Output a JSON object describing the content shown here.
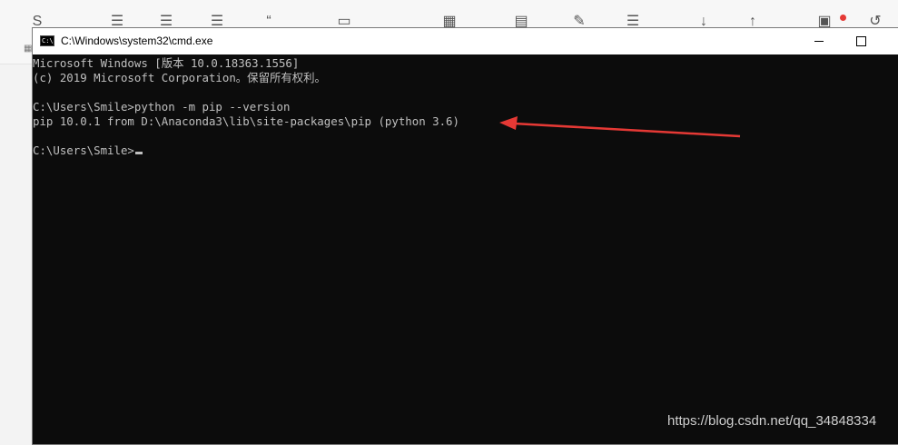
{
  "window": {
    "title": "C:\\Windows\\system32\\cmd.exe",
    "icon": "cmd-icon",
    "controls": [
      "minimize-icon",
      "maximize-icon",
      "close-icon"
    ]
  },
  "console": {
    "lines": [
      "Microsoft Windows [版本 10.0.18363.1556]",
      "(c) 2019 Microsoft Corporation。保留所有权利。",
      "",
      "C:\\Users\\Smile>python -m pip --version",
      "pip 10.0.1 from D:\\Anaconda3\\lib\\site-packages\\pip (python 3.6)",
      "",
      "C:\\Users\\Smile>"
    ]
  },
  "annotation": {
    "color": "#e53935"
  },
  "watermark": "https://blog.csdn.net/qq_34848334",
  "colors": {
    "console_bg": "#0c0c0c",
    "console_fg": "#c0c0c0"
  }
}
